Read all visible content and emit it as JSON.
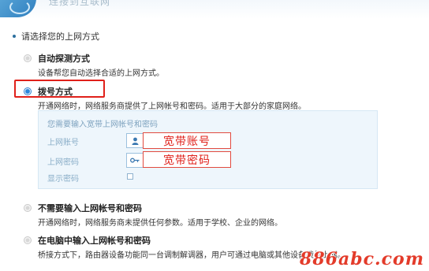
{
  "banner": {
    "title": "连接到互联网"
  },
  "section": {
    "heading": "请选择您的上网方式"
  },
  "options": [
    {
      "label": "自动探测方式",
      "desc": "设备帮您自动选择合适的上网方式。",
      "selected": false
    },
    {
      "label": "拨号方式",
      "desc": "开通网络时，网络服务商提供了上网帐号和密码。适用于大部分的家庭网络。",
      "selected": true
    },
    {
      "label": "不需要输入上网帐号和密码",
      "desc": "开通网络时，网络服务商未提供任何参数。适用于学校、企业的网络。",
      "selected": false
    },
    {
      "label": "在电脑中输入上网帐号和密码",
      "desc": "桥接方式下，路由器设备功能同一台调制解调器，用户可通过电脑或其他设备拨号上网。",
      "selected": false
    }
  ],
  "credentials": {
    "panel_title": "您需要输入宽带上网帐号和密码",
    "account_label": "上网账号",
    "password_label": "上网密码",
    "show_password_label": "显示密码",
    "account_annotation": "宽带账号",
    "password_annotation": "宽带密码",
    "show_password_checked": false
  },
  "icons": {
    "bullet": "bullet-dot-icon",
    "account": "user-icon",
    "password": "key-icon",
    "radio": "radio-icon"
  },
  "colors": {
    "accent": "#2a86db",
    "annotation_red": "#e0201a",
    "panel_bg": "#eef6fc"
  },
  "watermark": {
    "text": "886abc.com"
  }
}
